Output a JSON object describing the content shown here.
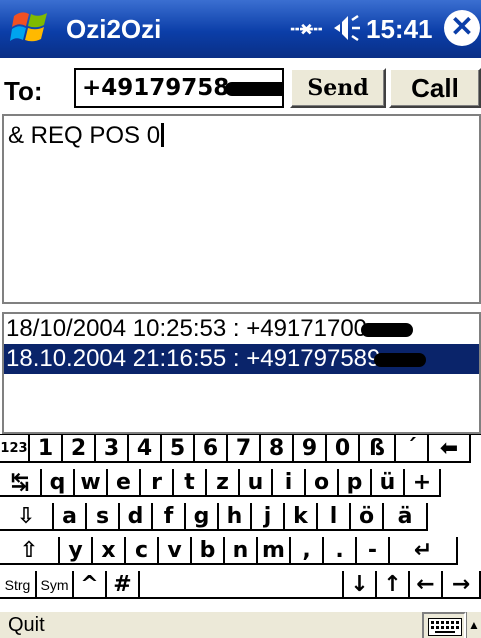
{
  "titlebar": {
    "app_title": "Ozi2Ozi",
    "clock": "15:41",
    "connectivity_icon": "connectivity-icon",
    "volume_icon": "speaker-icon",
    "close_symbol": "✕",
    "brand_color": "#0b3ea8"
  },
  "compose": {
    "to_label": "To:",
    "to_value": "+49179758",
    "send_label": "Send",
    "call_label": "Call",
    "message": "& REQ POS 0"
  },
  "log": {
    "items": [
      {
        "text": "18/10/2004 10:25:53 : +49171700",
        "selected": false
      },
      {
        "text": "18.10.2004 21:16:55 : +491797589",
        "selected": true
      }
    ],
    "selection_color": "#0a246a"
  },
  "keyboard": {
    "rows": [
      [
        "123",
        "1",
        "2",
        "3",
        "4",
        "5",
        "6",
        "7",
        "8",
        "9",
        "0",
        "ß",
        "´",
        "⬅"
      ],
      [
        "↹",
        "q",
        "w",
        "e",
        "r",
        "t",
        "z",
        "u",
        "i",
        "o",
        "p",
        "ü",
        "+"
      ],
      [
        "⇩",
        "a",
        "s",
        "d",
        "f",
        "g",
        "h",
        "j",
        "k",
        "l",
        "ö",
        "ä"
      ],
      [
        "⇧",
        "y",
        "x",
        "c",
        "v",
        "b",
        "n",
        "m",
        ",",
        ".",
        "-",
        "↵"
      ],
      [
        "Strg",
        "Sym",
        "^",
        "#",
        " ",
        "↓",
        "↑",
        "←",
        "→"
      ]
    ]
  },
  "menubar": {
    "left_label": "Quit",
    "sip_icon": "keyboard-icon",
    "sip_arrow": "▲"
  }
}
